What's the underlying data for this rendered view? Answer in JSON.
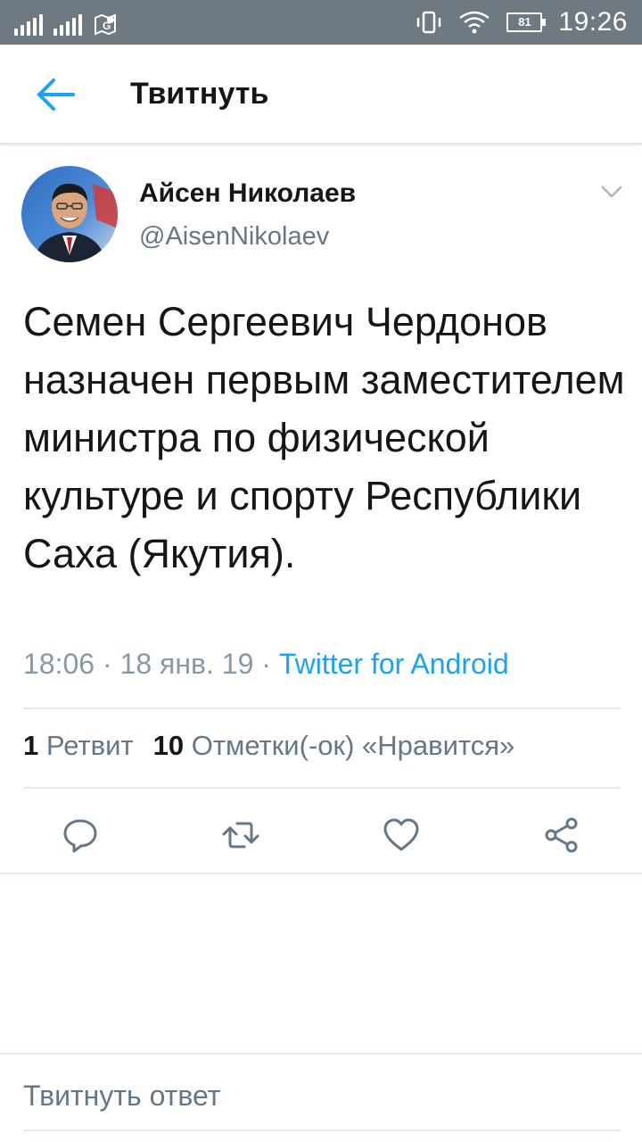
{
  "status_bar": {
    "time": "19:26",
    "battery": "81",
    "icons": [
      "signal-icon",
      "gps-icon",
      "vibrate-icon",
      "wifi-icon",
      "battery-icon"
    ]
  },
  "app_bar": {
    "title": "Твитнуть",
    "back_icon": "arrow-left-icon",
    "accent": "#1da1f2"
  },
  "tweet": {
    "author_name": "Айсен Николаев",
    "author_handle": "@AisenNikolaev",
    "text": "Семен Сергеевич Чердонов назначен первым заместителем министра по физической культуре и спорту Республики Саха (Якутия).",
    "time": "18:06",
    "date": "18 янв. 19",
    "separator": "·",
    "client": "Twitter for Android",
    "retweets_count": "1",
    "retweets_label": "Ретвит",
    "likes_count": "10",
    "likes_label": "Отметки(-ок) «Нравится»",
    "actions": [
      "reply-icon",
      "retweet-icon",
      "like-icon",
      "share-icon"
    ]
  },
  "reply": {
    "placeholder": "Твитнуть ответ"
  },
  "colors": {
    "status_bar": "#6e7982",
    "text": "#14171a",
    "secondary": "#657786",
    "divider": "#e1e8ed"
  }
}
